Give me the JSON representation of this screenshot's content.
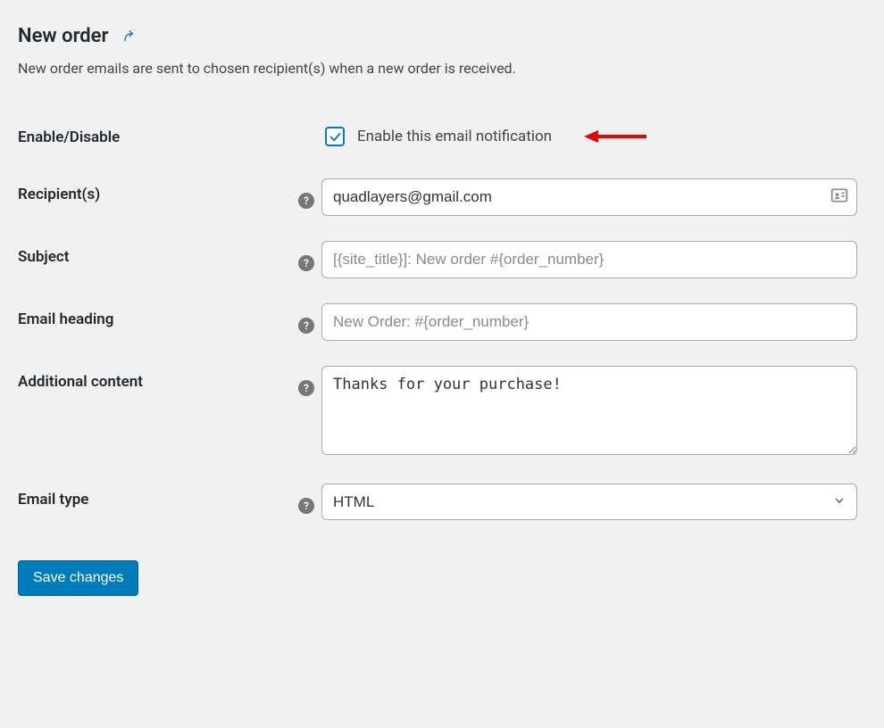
{
  "page": {
    "title": "New order",
    "description": "New order emails are sent to chosen recipient(s) when a new order is received."
  },
  "fields": {
    "enable": {
      "label": "Enable/Disable",
      "checkbox_label": "Enable this email notification",
      "checked": true
    },
    "recipients": {
      "label": "Recipient(s)",
      "value": "quadlayers@gmail.com",
      "placeholder": ""
    },
    "subject": {
      "label": "Subject",
      "value": "",
      "placeholder": "[{site_title}]: New order #{order_number}"
    },
    "heading": {
      "label": "Email heading",
      "value": "",
      "placeholder": "New Order: #{order_number}"
    },
    "additional": {
      "label": "Additional content",
      "value": "Thanks for your purchase!",
      "placeholder": ""
    },
    "email_type": {
      "label": "Email type",
      "selected": "HTML"
    }
  },
  "buttons": {
    "save": "Save changes"
  },
  "icons": {
    "help": "?"
  }
}
